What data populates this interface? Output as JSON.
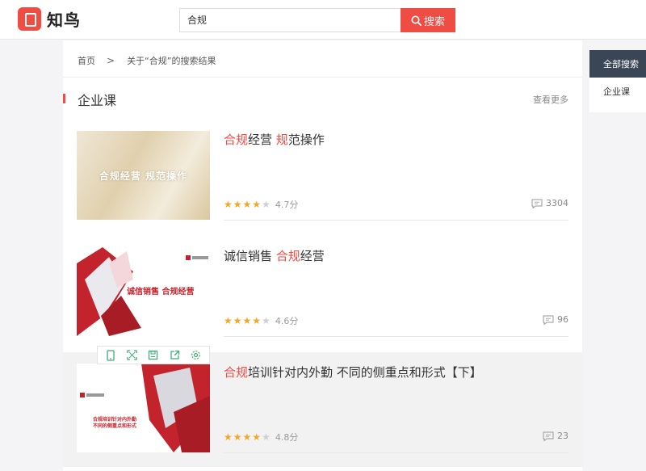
{
  "header": {
    "logo_text": "知鸟",
    "search_value": "合规",
    "search_button": "搜索",
    "accent_color": "#ef4c43"
  },
  "breadcrumb": {
    "home": "首页",
    "separator": ">",
    "current": "关于“合规”的搜索结果"
  },
  "section": {
    "title": "企业课",
    "see_more": "查看更多"
  },
  "courses": [
    {
      "title_parts": [
        {
          "text": "合规",
          "highlight": true
        },
        {
          "text": "经营 ",
          "highlight": false
        },
        {
          "text": "规",
          "highlight": true
        },
        {
          "text": "范操作",
          "highlight": false
        }
      ],
      "thumb_text": "合规经营 规范操作",
      "stars": 4,
      "score": "4.7分",
      "comments": "3304"
    },
    {
      "title_parts": [
        {
          "text": "诚信销售 ",
          "highlight": false
        },
        {
          "text": "合规",
          "highlight": true
        },
        {
          "text": "经营",
          "highlight": false
        }
      ],
      "thumb_text": "诚信销售 合规经营",
      "stars": 4,
      "score": "4.6分",
      "comments": "96"
    },
    {
      "title_parts": [
        {
          "text": "合规",
          "highlight": true
        },
        {
          "text": "培训针对内外勤 不同的侧重点和形式【下】",
          "highlight": false
        }
      ],
      "thumb_text": "合规培训针对内外勤 不同的侧重点和形式",
      "stars": 4,
      "score": "4.8分",
      "comments": "23"
    }
  ],
  "toolbar_icons": [
    "mobile-icon",
    "fullscreen-icon",
    "save-icon",
    "share-icon",
    "settings-icon"
  ],
  "sidebar": {
    "items": [
      {
        "label": "全部搜索",
        "active": true
      },
      {
        "label": "企业课",
        "active": false
      }
    ]
  }
}
